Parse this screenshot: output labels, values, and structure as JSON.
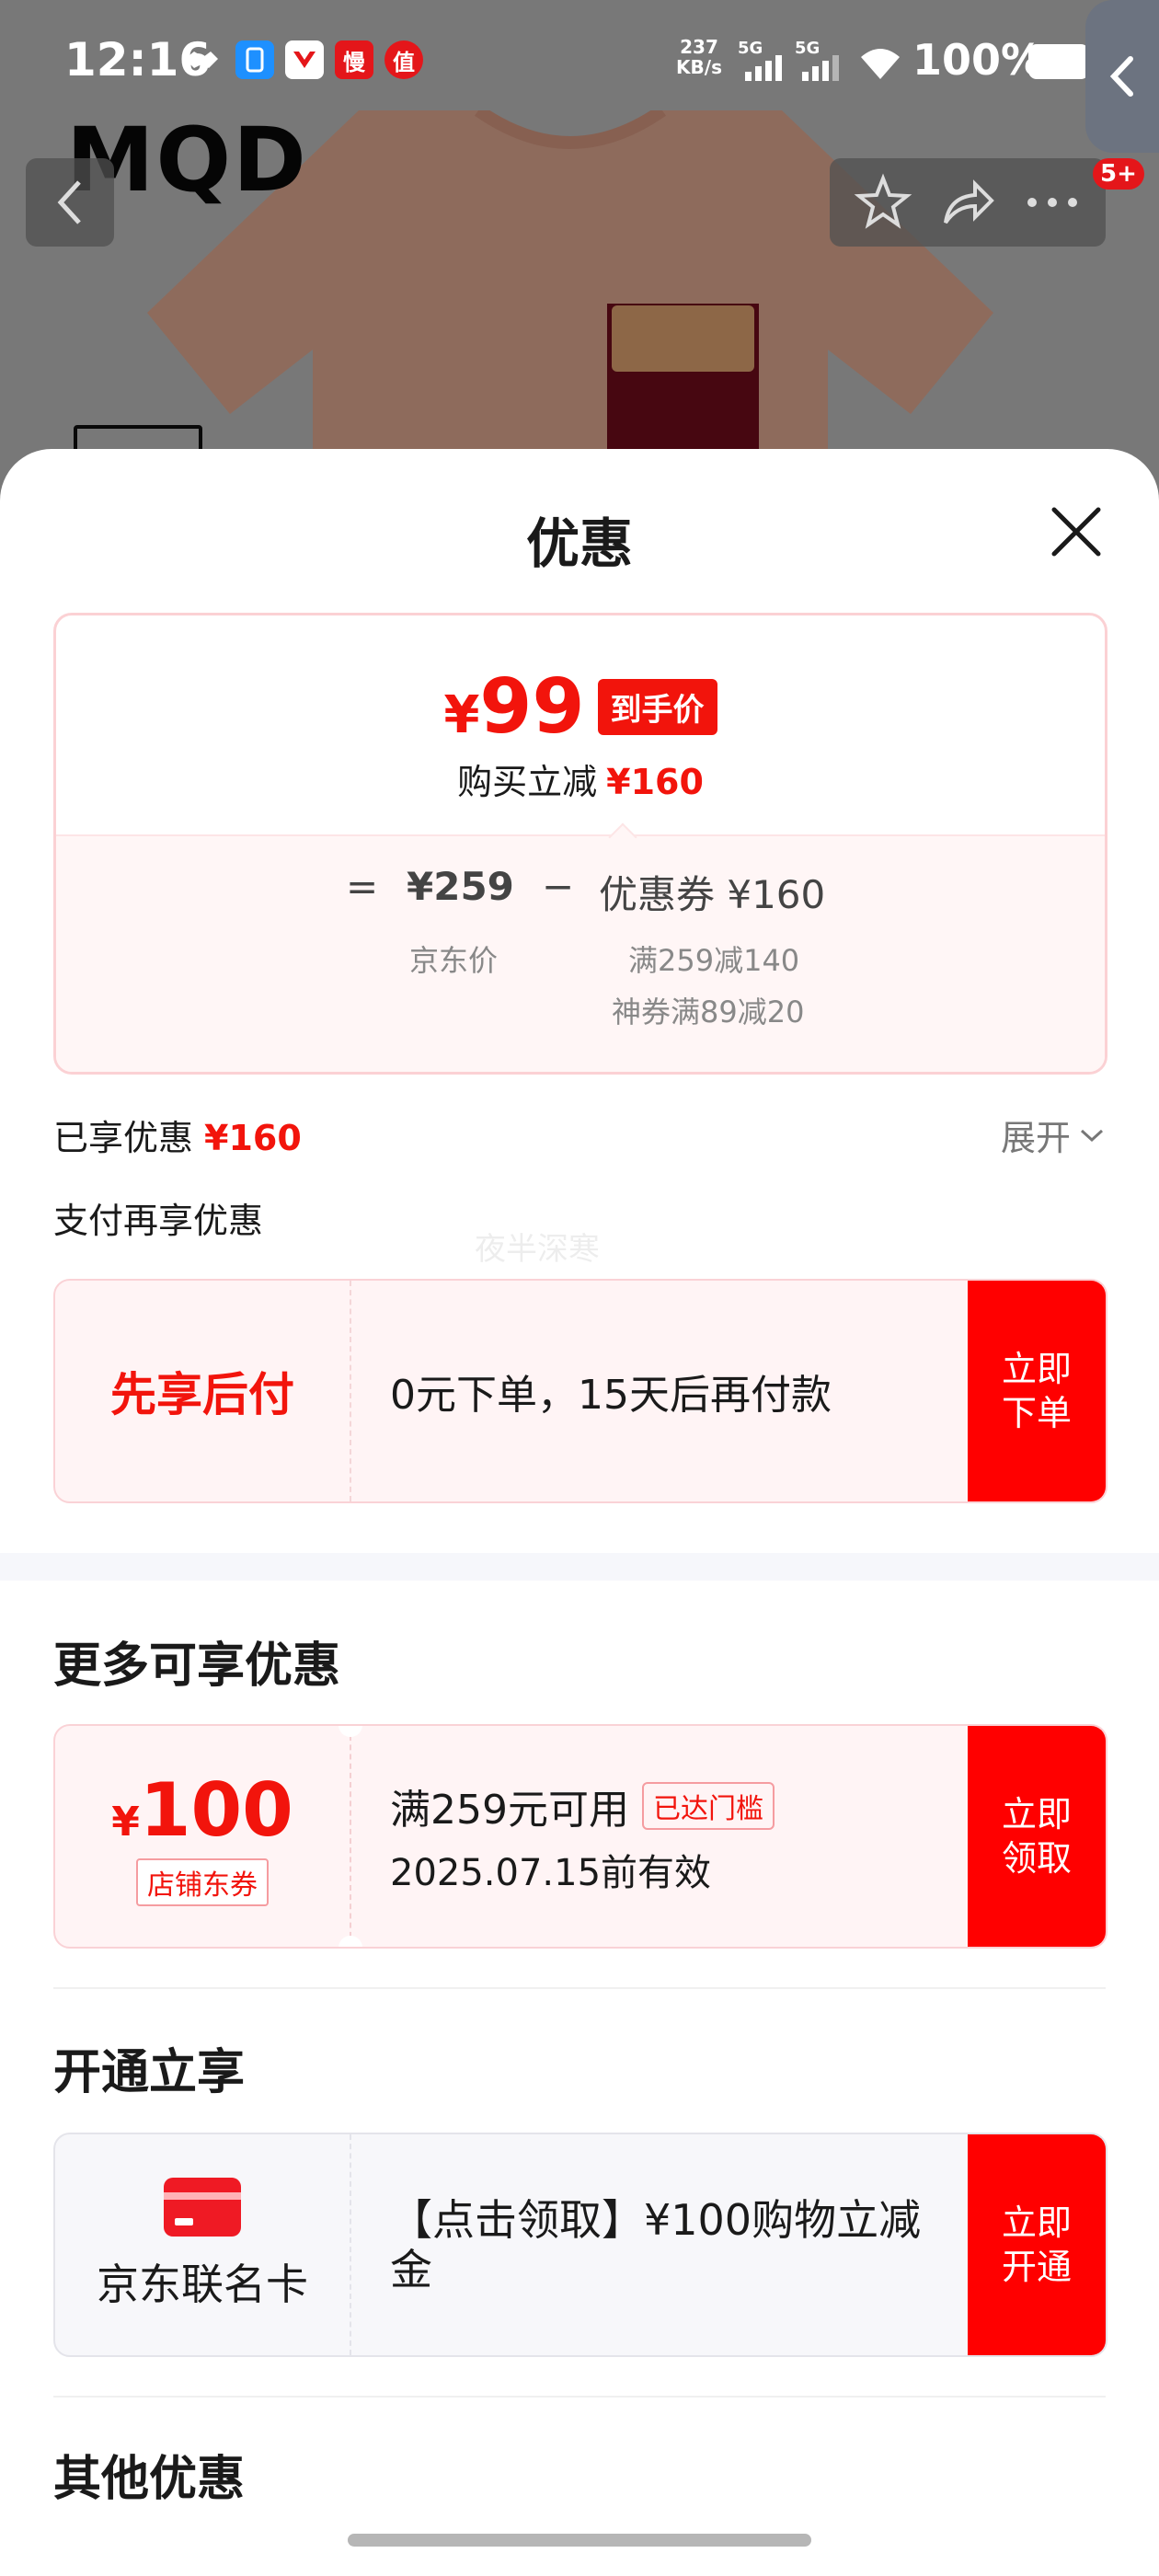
{
  "status_bar": {
    "time": "12:16",
    "net_speed_value": "237",
    "net_speed_unit": "KB/s",
    "signal_1": "5G",
    "signal_2": "5G",
    "battery": "100%",
    "notification_icons": [
      "handshake-icon",
      "phone-card-icon",
      "news-icon",
      "manga-icon",
      "value-icon"
    ],
    "notif_labels": [
      "",
      "",
      "",
      "慢",
      "值"
    ]
  },
  "product_bg": {
    "brand": "MQD",
    "cart_badge": "5+"
  },
  "sheet": {
    "title": "优惠",
    "price_summary": {
      "currency": "¥",
      "final_price": "99",
      "final_tag": "到手价",
      "reduce_label": "购买立减",
      "reduce_amount": "¥160",
      "equals": "=",
      "minus": "−",
      "jd_price": "¥259",
      "jd_price_label": "京东价",
      "coupon_total": "优惠券 ¥160",
      "coupon_detail_1": "满259减140",
      "coupon_detail_2": "神券满89减20"
    },
    "enjoyed_label": "已享优惠",
    "enjoyed_amount": "¥160",
    "expand_label": "展开",
    "pay_again_label": "支付再享优惠",
    "watermark": "夜半深寒",
    "bnpl": {
      "title": "先享后付",
      "text": "0元下单，15天后再付款",
      "button": "立即\n下单"
    },
    "more_title": "更多可享优惠",
    "shop_coupon": {
      "currency": "¥",
      "value": "100",
      "tag": "店铺东券",
      "condition": "满259元可用",
      "reached_tag": "已达门槛",
      "expire": "2025.07.15前有效",
      "button": "立即\n领取"
    },
    "open_title": "开通立享",
    "co_card": {
      "name": "京东联名卡",
      "offer": "【点击领取】¥100购物立减金",
      "button": "立即\n开通"
    },
    "other_title": "其他优惠"
  },
  "colors": {
    "accent_red": "#f2140c",
    "button_red": "#ff0000",
    "card_pink_bg": "#fff4f5"
  }
}
